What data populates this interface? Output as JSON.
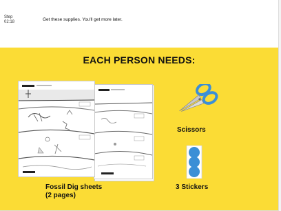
{
  "header": {
    "step_label": "Step",
    "step_code": "02:18",
    "instruction": "Get these supplies. You'll get more later."
  },
  "panel": {
    "title": "EACH PERSON NEEDS:",
    "background_color": "#fbdc35"
  },
  "items": {
    "sheets": {
      "label_line1": "Fossil Dig sheets",
      "label_line2": "(2 pages)",
      "icon": "fossil-dig-sheets-icon"
    },
    "scissors": {
      "label": "Scissors",
      "icon": "scissors-icon"
    },
    "stickers": {
      "label": "3 Stickers",
      "icon": "stickers-icon"
    }
  }
}
